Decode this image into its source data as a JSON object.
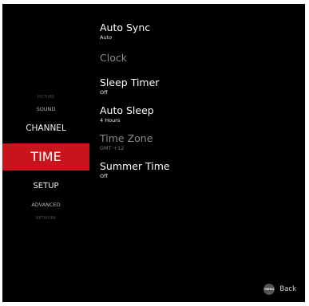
{
  "menu": {
    "items": [
      {
        "label": "PICTURE",
        "selected": false
      },
      {
        "label": "SOUND",
        "selected": false
      },
      {
        "label": "CHANNEL",
        "selected": false
      },
      {
        "label": "TIME",
        "selected": true
      },
      {
        "label": "SETUP",
        "selected": false
      },
      {
        "label": "ADVANCED",
        "selected": false
      },
      {
        "label": "NETWORK",
        "selected": false
      }
    ]
  },
  "settings": [
    {
      "label": "Auto Sync",
      "value": "Auto",
      "enabled": true
    },
    {
      "label": "Clock",
      "value": "",
      "enabled": false
    },
    {
      "label": "Sleep Timer",
      "value": "Off",
      "enabled": true
    },
    {
      "label": "Auto Sleep",
      "value": "4 Hours",
      "enabled": true
    },
    {
      "label": "Time Zone",
      "value": "GMT +12",
      "enabled": false
    },
    {
      "label": "Summer Time",
      "value": "Off",
      "enabled": true
    }
  ],
  "footer": {
    "menu_button_text": "MENU",
    "back_label": "Back"
  },
  "colors": {
    "background": "#000000",
    "highlight": "#c8141c",
    "text": "#ffffff",
    "disabled_text": "#8a8a8a"
  }
}
